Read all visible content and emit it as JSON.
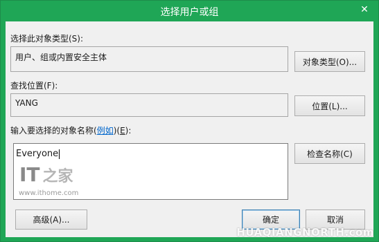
{
  "window": {
    "title": "选择用户或组",
    "close_icon": "close-icon",
    "close_glyph": "✕"
  },
  "object_type": {
    "label": "选择此对象类型(S):",
    "value": "用户、组或内置安全主体",
    "button": "对象类型(O)..."
  },
  "location": {
    "label": "查找位置(F):",
    "value": "YANG",
    "button": "位置(L)..."
  },
  "names": {
    "label_prefix": "输入要选择的对象名称(",
    "label_link": "例如",
    "label_middle": ")(",
    "label_key": "E",
    "label_suffix": "):",
    "value": "Everyone",
    "check_button": "检查名称(C)"
  },
  "footer": {
    "advanced_button": "高级(A)...",
    "ok_button": "确定",
    "cancel_button": "取消"
  },
  "watermarks": {
    "it_logo": "IT",
    "home_logo": "之家",
    "url": "www.ithome.com",
    "corner": "HUAQIANGNORTH.com"
  },
  "colors": {
    "title_bar": "#1fa656",
    "client_bg": "#f0f0f0",
    "link": "#0066cc"
  }
}
